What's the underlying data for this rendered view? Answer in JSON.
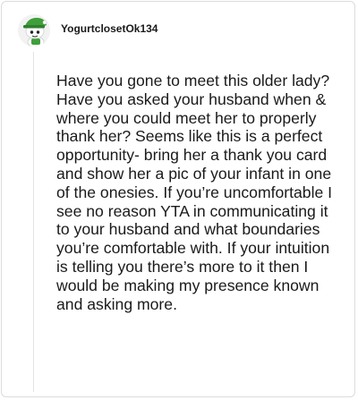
{
  "comment": {
    "author": {
      "username": "YogurtclosetOk134",
      "avatar_icon": "snoo-avatar-green-hat-icon"
    },
    "body": "Have you gone to meet this older lady? Have you asked your husband when & where you could meet her to properly thank her? Seems like this is a perfect opportunity- bring her a thank you card and show her a pic of your infant in one of the onesies. If you’re uncomfortable I see no reason YTA in communicating it to your husband and what boundaries you’re comfortable with. If your intuition is telling you there’s more to it then I would be making my presence known and asking more."
  },
  "colors": {
    "avatar_green": "#3f9f3a",
    "text": "#1a1a1b",
    "thread_line": "#e3e3e3"
  }
}
